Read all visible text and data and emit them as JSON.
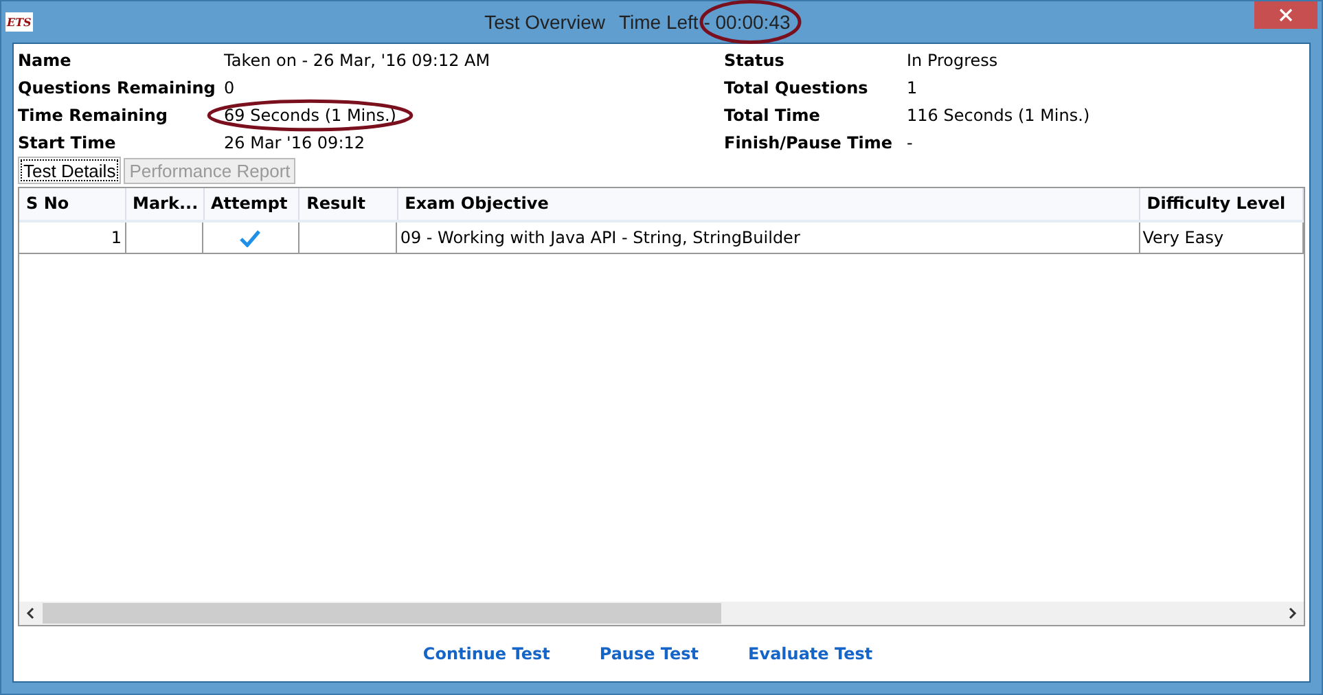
{
  "window": {
    "logo": "ETS",
    "title": "Test Overview",
    "time_left_label": "Time Left - ",
    "time_left": "00:00:43"
  },
  "info_left": [
    {
      "label": "Name",
      "value": "Taken on - 26 Mar, '16 09:12 AM",
      "circled": false
    },
    {
      "label": "Questions Remaining",
      "value": "0",
      "circled": false
    },
    {
      "label": "Time Remaining",
      "value": "69 Seconds (1 Mins.)",
      "circled": true
    },
    {
      "label": "Start Time",
      "value": "26 Mar '16 09:12",
      "circled": false
    }
  ],
  "info_right": [
    {
      "label": "Status",
      "value": "In Progress"
    },
    {
      "label": "Total Questions",
      "value": "1"
    },
    {
      "label": "Total Time",
      "value": "116 Seconds (1 Mins.)"
    },
    {
      "label": "Finish/Pause Time",
      "value": "-"
    }
  ],
  "tabs": [
    {
      "label": "Test Details",
      "selected": true
    },
    {
      "label": "Performance Report",
      "selected": false
    }
  ],
  "table": {
    "columns": [
      "S No",
      "Mark...",
      "Attempt",
      "Result",
      "Exam Objective",
      "Difficulty Level"
    ],
    "rows": [
      {
        "s_no": "1",
        "attempted": true,
        "objective": "09 - Working with Java API - String, StringBuilder",
        "difficulty": "Very Easy"
      }
    ]
  },
  "buttons": [
    "Continue Test",
    "Pause Test",
    "Evaluate Test"
  ]
}
